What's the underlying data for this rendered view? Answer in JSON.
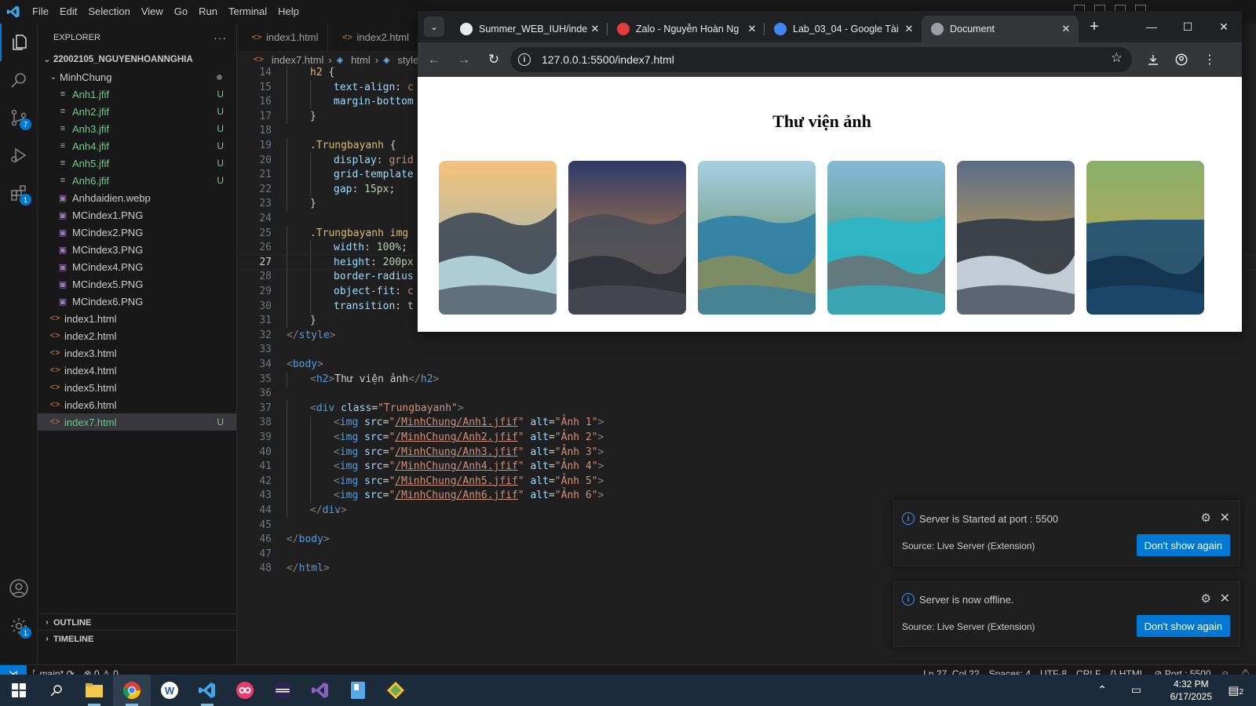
{
  "menu": [
    "File",
    "Edit",
    "Selection",
    "View",
    "Go",
    "Run",
    "Terminal",
    "Help"
  ],
  "activity": {
    "source_control_badge": "7",
    "extensions_badge": "1",
    "settings_badge": "1"
  },
  "explorer": {
    "title": "EXPLORER",
    "more": "···",
    "root": "22002105_NGUYENHOANNGHIA",
    "folder": "MinhChung",
    "files": [
      {
        "name": "Anh1.jfif",
        "status": "U"
      },
      {
        "name": "Anh2.jfif",
        "status": "U"
      },
      {
        "name": "Anh3.jfif",
        "status": "U"
      },
      {
        "name": "Anh4.jfif",
        "status": "U"
      },
      {
        "name": "Anh5.jfif",
        "status": "U"
      },
      {
        "name": "Anh6.jfif",
        "status": "U"
      },
      {
        "name": "Anhdaidien.webp",
        "status": ""
      },
      {
        "name": "MCindex1.PNG",
        "status": ""
      },
      {
        "name": "MCindex2.PNG",
        "status": ""
      },
      {
        "name": "MCindex3.PNG",
        "status": ""
      },
      {
        "name": "MCindex4.PNG",
        "status": ""
      },
      {
        "name": "MCindex5.PNG",
        "status": ""
      },
      {
        "name": "MCindex6.PNG",
        "status": ""
      }
    ],
    "root_files": [
      {
        "name": "index1.html",
        "status": ""
      },
      {
        "name": "index2.html",
        "status": ""
      },
      {
        "name": "index3.html",
        "status": ""
      },
      {
        "name": "index4.html",
        "status": ""
      },
      {
        "name": "index5.html",
        "status": ""
      },
      {
        "name": "index6.html",
        "status": ""
      },
      {
        "name": "index7.html",
        "status": "U"
      }
    ],
    "outline": "OUTLINE",
    "timeline": "TIMELINE"
  },
  "editor": {
    "tabs": [
      "index1.html",
      "index2.html"
    ],
    "breadcrumb": [
      "index7.html",
      "html",
      "style"
    ],
    "current_line": "27",
    "lines": [
      {
        "n": "14",
        "indent": 1,
        "parts": [
          [
            "sel",
            "h2"
          ],
          [
            "punc",
            " {"
          ]
        ]
      },
      {
        "n": "15",
        "indent": 2,
        "parts": [
          [
            "prop",
            "text-align"
          ],
          [
            "punc",
            ": "
          ],
          [
            "str",
            "c"
          ]
        ]
      },
      {
        "n": "16",
        "indent": 2,
        "parts": [
          [
            "prop",
            "margin-bottom"
          ]
        ]
      },
      {
        "n": "17",
        "indent": 1,
        "parts": [
          [
            "punc",
            "}"
          ]
        ]
      },
      {
        "n": "18",
        "indent": 0,
        "parts": []
      },
      {
        "n": "19",
        "indent": 1,
        "parts": [
          [
            "sel",
            ".Trungbayanh"
          ],
          [
            "punc",
            " {"
          ]
        ]
      },
      {
        "n": "20",
        "indent": 2,
        "parts": [
          [
            "prop",
            "display"
          ],
          [
            "punc",
            ": "
          ],
          [
            "str",
            "grid"
          ]
        ]
      },
      {
        "n": "21",
        "indent": 2,
        "parts": [
          [
            "prop",
            "grid-template"
          ]
        ]
      },
      {
        "n": "22",
        "indent": 2,
        "parts": [
          [
            "prop",
            "gap"
          ],
          [
            "punc",
            ": "
          ],
          [
            "num",
            "15px"
          ],
          [
            "punc",
            ";"
          ]
        ]
      },
      {
        "n": "23",
        "indent": 1,
        "parts": [
          [
            "punc",
            "}"
          ]
        ]
      },
      {
        "n": "24",
        "indent": 0,
        "parts": []
      },
      {
        "n": "25",
        "indent": 1,
        "parts": [
          [
            "sel",
            ".Trungbayanh img"
          ]
        ]
      },
      {
        "n": "26",
        "indent": 2,
        "parts": [
          [
            "prop",
            "width"
          ],
          [
            "punc",
            ": "
          ],
          [
            "num",
            "100%"
          ],
          [
            "punc",
            ";"
          ]
        ]
      },
      {
        "n": "27",
        "indent": 2,
        "parts": [
          [
            "prop",
            "height"
          ],
          [
            "punc",
            ": "
          ],
          [
            "num",
            "200px"
          ]
        ]
      },
      {
        "n": "28",
        "indent": 2,
        "parts": [
          [
            "prop",
            "border-radius"
          ]
        ]
      },
      {
        "n": "29",
        "indent": 2,
        "parts": [
          [
            "prop",
            "object-fit"
          ],
          [
            "punc",
            ": "
          ],
          [
            "str",
            "c"
          ]
        ]
      },
      {
        "n": "30",
        "indent": 2,
        "parts": [
          [
            "prop",
            "transition"
          ],
          [
            "punc",
            ": "
          ],
          [
            "punc",
            "t"
          ]
        ]
      },
      {
        "n": "31",
        "indent": 1,
        "parts": [
          [
            "punc",
            "}"
          ]
        ]
      },
      {
        "n": "32",
        "indent": 0,
        "parts": [
          [
            "ang",
            "</"
          ],
          [
            "tag",
            "style"
          ],
          [
            "ang",
            ">"
          ]
        ]
      },
      {
        "n": "33",
        "indent": 0,
        "parts": []
      },
      {
        "n": "34",
        "indent": 0,
        "parts": [
          [
            "ang",
            "<"
          ],
          [
            "tag",
            "body"
          ],
          [
            "ang",
            ">"
          ]
        ]
      },
      {
        "n": "35",
        "indent": 1,
        "parts": [
          [
            "ang",
            "<"
          ],
          [
            "tag",
            "h2"
          ],
          [
            "ang",
            ">"
          ],
          [
            "punc",
            "Thư viện ảnh"
          ],
          [
            "ang",
            "</"
          ],
          [
            "tag",
            "h2"
          ],
          [
            "ang",
            ">"
          ]
        ]
      },
      {
        "n": "36",
        "indent": 0,
        "parts": []
      },
      {
        "n": "37",
        "indent": 1,
        "parts": [
          [
            "ang",
            "<"
          ],
          [
            "tag",
            "div"
          ],
          [
            "punc",
            " "
          ],
          [
            "attr",
            "class"
          ],
          [
            "punc",
            "="
          ],
          [
            "str",
            "\"Trungbayanh\""
          ],
          [
            "ang",
            ">"
          ]
        ]
      },
      {
        "n": "38",
        "indent": 2,
        "parts": [
          [
            "ang",
            "<"
          ],
          [
            "tag",
            "img"
          ],
          [
            "punc",
            " "
          ],
          [
            "attr",
            "src"
          ],
          [
            "punc",
            "="
          ],
          [
            "str",
            "\""
          ],
          [
            "link",
            "/MinhChung/Anh1.jfif"
          ],
          [
            "str",
            "\""
          ],
          [
            "punc",
            " "
          ],
          [
            "attr",
            "alt"
          ],
          [
            "punc",
            "="
          ],
          [
            "str",
            "\"Ảnh 1\""
          ],
          [
            "ang",
            ">"
          ]
        ]
      },
      {
        "n": "39",
        "indent": 2,
        "parts": [
          [
            "ang",
            "<"
          ],
          [
            "tag",
            "img"
          ],
          [
            "punc",
            " "
          ],
          [
            "attr",
            "src"
          ],
          [
            "punc",
            "="
          ],
          [
            "str",
            "\""
          ],
          [
            "link",
            "/MinhChung/Anh2.jfif"
          ],
          [
            "str",
            "\""
          ],
          [
            "punc",
            " "
          ],
          [
            "attr",
            "alt"
          ],
          [
            "punc",
            "="
          ],
          [
            "str",
            "\"Ảnh 2\""
          ],
          [
            "ang",
            ">"
          ]
        ]
      },
      {
        "n": "40",
        "indent": 2,
        "parts": [
          [
            "ang",
            "<"
          ],
          [
            "tag",
            "img"
          ],
          [
            "punc",
            " "
          ],
          [
            "attr",
            "src"
          ],
          [
            "punc",
            "="
          ],
          [
            "str",
            "\""
          ],
          [
            "link",
            "/MinhChung/Anh3.jfif"
          ],
          [
            "str",
            "\""
          ],
          [
            "punc",
            " "
          ],
          [
            "attr",
            "alt"
          ],
          [
            "punc",
            "="
          ],
          [
            "str",
            "\"Ảnh 3\""
          ],
          [
            "ang",
            ">"
          ]
        ]
      },
      {
        "n": "41",
        "indent": 2,
        "parts": [
          [
            "ang",
            "<"
          ],
          [
            "tag",
            "img"
          ],
          [
            "punc",
            " "
          ],
          [
            "attr",
            "src"
          ],
          [
            "punc",
            "="
          ],
          [
            "str",
            "\""
          ],
          [
            "link",
            "/MinhChung/Anh4.jfif"
          ],
          [
            "str",
            "\""
          ],
          [
            "punc",
            " "
          ],
          [
            "attr",
            "alt"
          ],
          [
            "punc",
            "="
          ],
          [
            "str",
            "\"Ảnh 4\""
          ],
          [
            "ang",
            ">"
          ]
        ]
      },
      {
        "n": "42",
        "indent": 2,
        "parts": [
          [
            "ang",
            "<"
          ],
          [
            "tag",
            "img"
          ],
          [
            "punc",
            " "
          ],
          [
            "attr",
            "src"
          ],
          [
            "punc",
            "="
          ],
          [
            "str",
            "\""
          ],
          [
            "link",
            "/MinhChung/Anh5.jfif"
          ],
          [
            "str",
            "\""
          ],
          [
            "punc",
            " "
          ],
          [
            "attr",
            "alt"
          ],
          [
            "punc",
            "="
          ],
          [
            "str",
            "\"Ảnh 5\""
          ],
          [
            "ang",
            ">"
          ]
        ]
      },
      {
        "n": "43",
        "indent": 2,
        "parts": [
          [
            "ang",
            "<"
          ],
          [
            "tag",
            "img"
          ],
          [
            "punc",
            " "
          ],
          [
            "attr",
            "src"
          ],
          [
            "punc",
            "="
          ],
          [
            "str",
            "\""
          ],
          [
            "link",
            "/MinhChung/Anh6.jfif"
          ],
          [
            "str",
            "\""
          ],
          [
            "punc",
            " "
          ],
          [
            "attr",
            "alt"
          ],
          [
            "punc",
            "="
          ],
          [
            "str",
            "\"Ảnh 6\""
          ],
          [
            "ang",
            ">"
          ]
        ]
      },
      {
        "n": "44",
        "indent": 1,
        "parts": [
          [
            "ang",
            "</"
          ],
          [
            "tag",
            "div"
          ],
          [
            "ang",
            ">"
          ]
        ]
      },
      {
        "n": "45",
        "indent": 0,
        "parts": []
      },
      {
        "n": "46",
        "indent": 0,
        "parts": [
          [
            "ang",
            "</"
          ],
          [
            "tag",
            "body"
          ],
          [
            "ang",
            ">"
          ]
        ]
      },
      {
        "n": "47",
        "indent": 0,
        "parts": []
      },
      {
        "n": "48",
        "indent": 0,
        "parts": [
          [
            "ang",
            "</"
          ],
          [
            "tag",
            "html"
          ],
          [
            "ang",
            ">"
          ]
        ]
      }
    ]
  },
  "browser": {
    "tabs": [
      {
        "title": "Summer_WEB_IUH/inde",
        "favicon": "github-icon",
        "color": "#e8eaed",
        "active": false
      },
      {
        "title": "Zalo - Nguyễn Hoàn Ng",
        "favicon": "zalo-icon",
        "color": "#e23c3c",
        "active": false
      },
      {
        "title": "Lab_03_04 - Google Tài",
        "favicon": "google-docs-icon",
        "color": "#4285f4",
        "active": false
      },
      {
        "title": "Document",
        "favicon": "globe-icon",
        "color": "#9aa0a6",
        "active": true
      }
    ],
    "url": "127.0.0.1:5500/index7.html",
    "page": {
      "heading": "Thư viện ảnh",
      "photos": [
        {
          "alt": "Ảnh 1",
          "palette": [
            "#f6c27a",
            "#7fb4c9",
            "#3f4a55",
            "#bfe3ea"
          ]
        },
        {
          "alt": "Ảnh 2",
          "palette": [
            "#2d3a6a",
            "#f39a3a",
            "#4a4e58",
            "#2b2f36"
          ]
        },
        {
          "alt": "Ảnh 3",
          "palette": [
            "#a7cfe3",
            "#4e7a3a",
            "#2f7fa6",
            "#8a8f5a"
          ]
        },
        {
          "alt": "Ảnh 4",
          "palette": [
            "#87b9d9",
            "#3f8a3f",
            "#29b7c9",
            "#6c6f72"
          ]
        },
        {
          "alt": "Ảnh 5",
          "palette": [
            "#5a6c86",
            "#f1b640",
            "#303a48",
            "#d9e4ee"
          ]
        },
        {
          "alt": "Ảnh 6",
          "palette": [
            "#8ab06a",
            "#c9a24f",
            "#1d4e73",
            "#0f2f4a"
          ]
        }
      ]
    }
  },
  "notifications": [
    {
      "message": "Server is Started at port : 5500",
      "source": "Source: Live Server (Extension)",
      "button": "Don't show again"
    },
    {
      "message": "Server is now offline.",
      "source": "Source: Live Server (Extension)",
      "button": "Don't show again"
    }
  ],
  "statusbar": {
    "branch": "main*",
    "problems": "⊗ 0 ⚠ 0",
    "position": "Ln 27, Col 22",
    "spaces": "Spaces: 4",
    "encoding": "UTF-8",
    "eol": "CRLF",
    "language": "HTML",
    "port": "Port : 5500"
  },
  "taskbar": {
    "time": "4:32 PM",
    "date": "6/17/2025",
    "notification_count": "2"
  },
  "colors": {
    "accent": "#0078d4",
    "editor_bg": "#1f1f1f",
    "sidebar_bg": "#181818",
    "untracked": "#73c991"
  }
}
